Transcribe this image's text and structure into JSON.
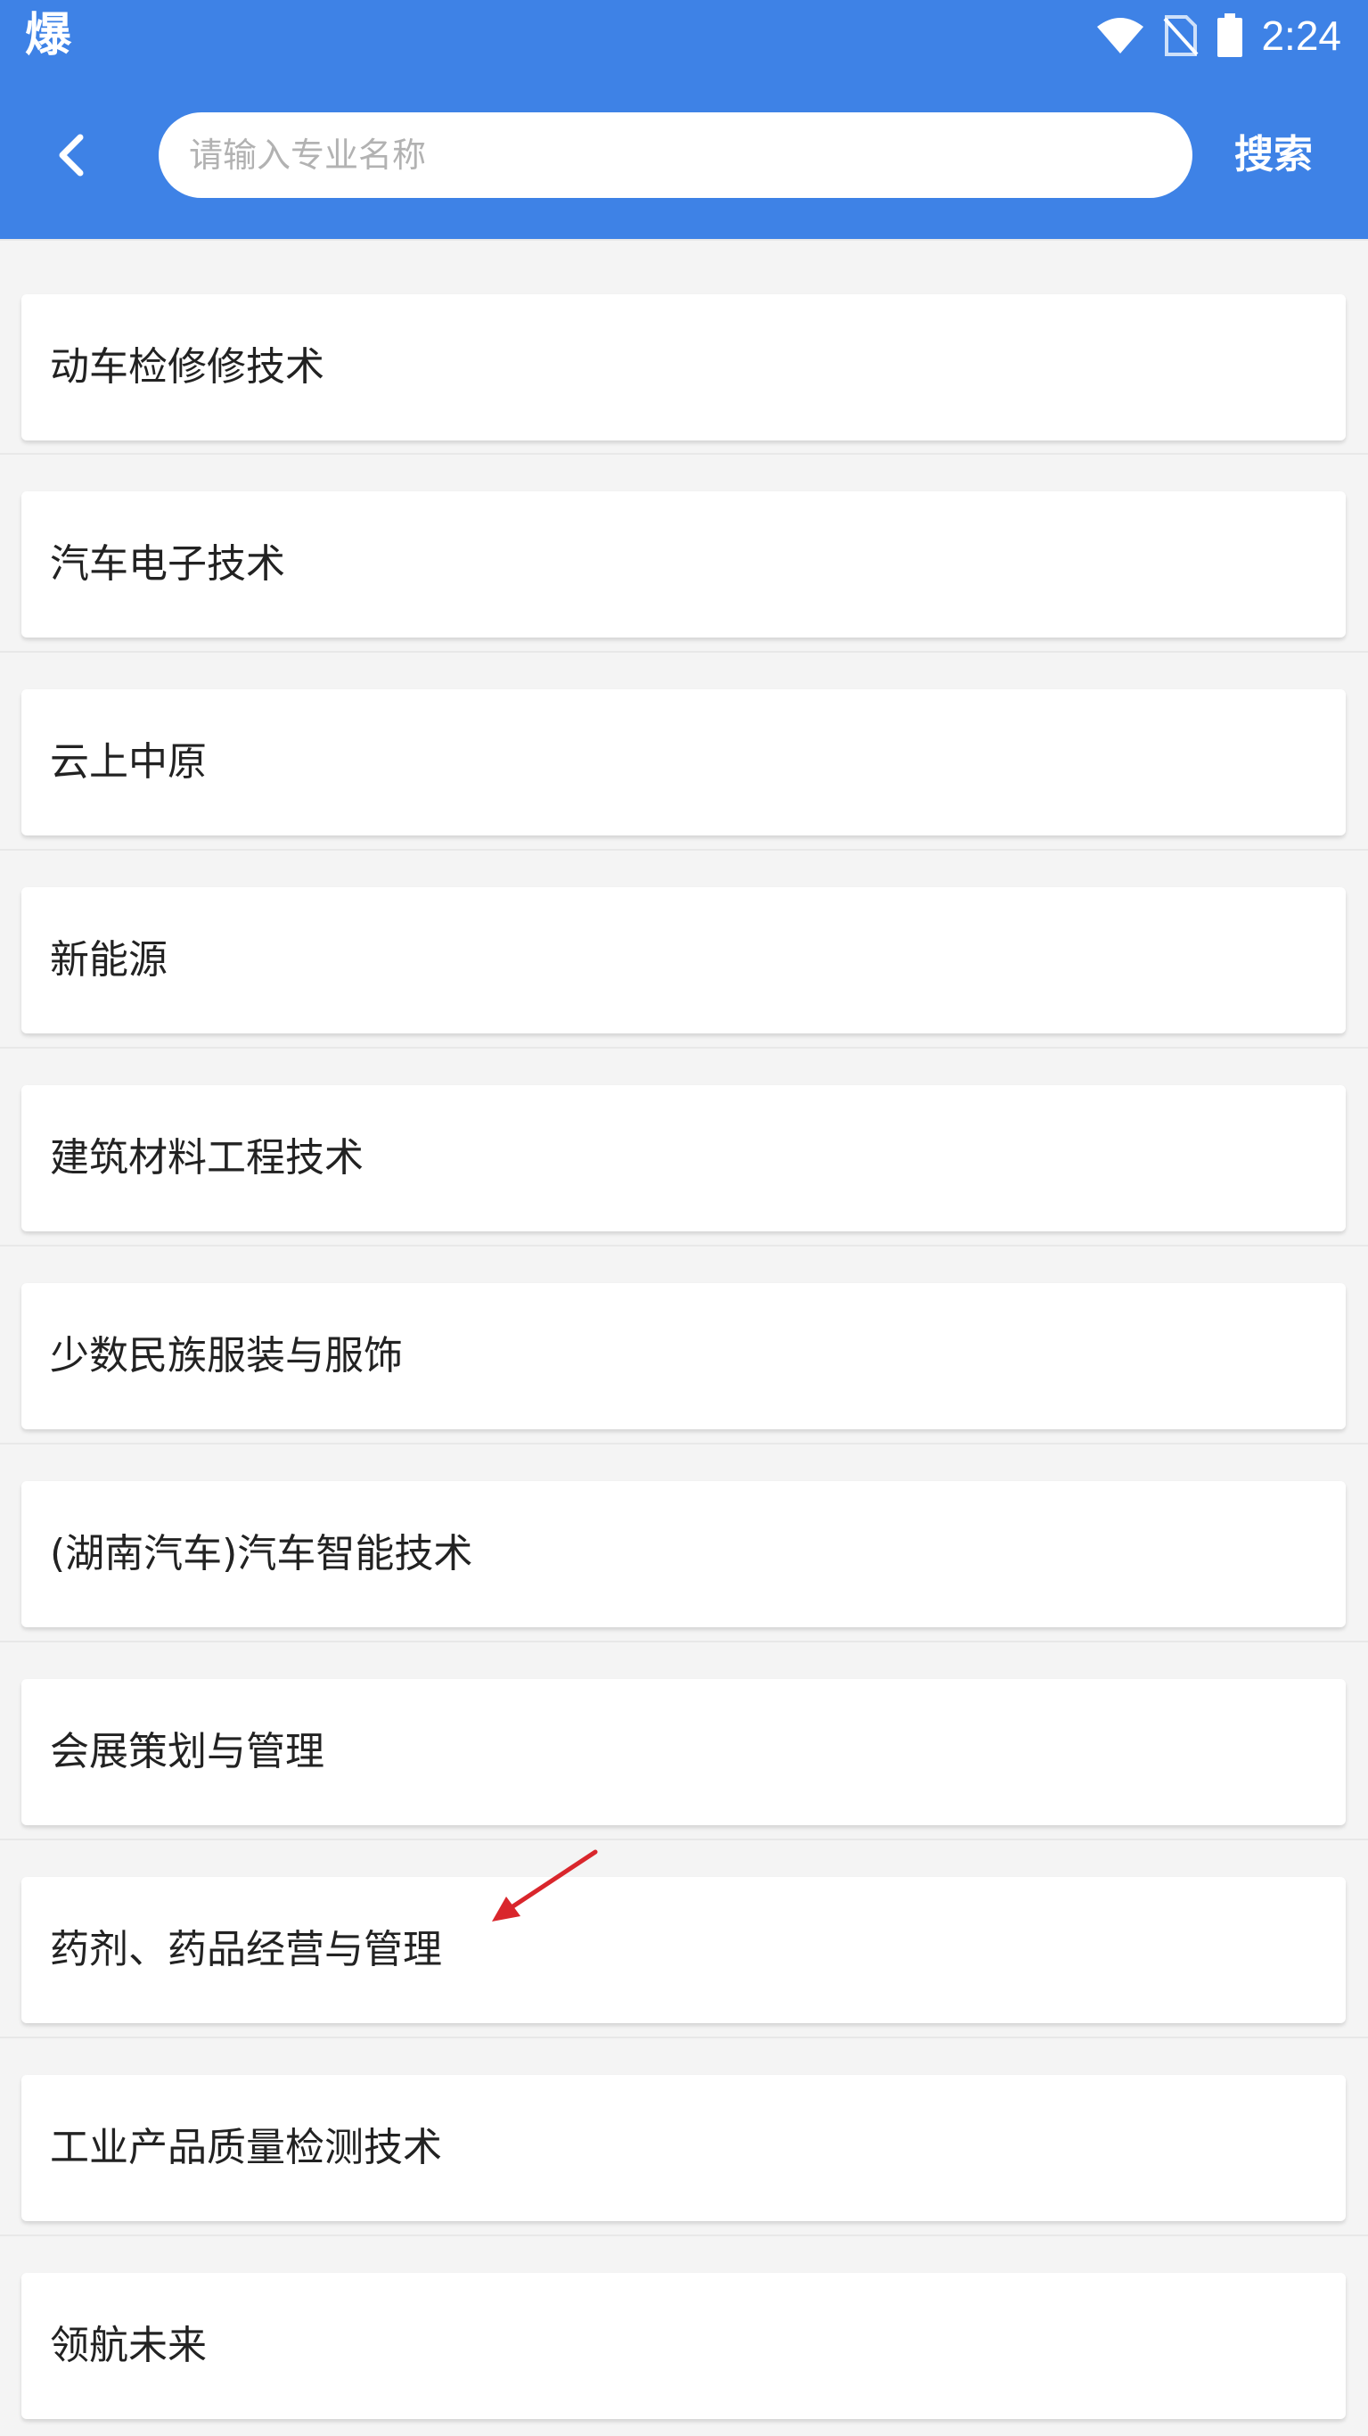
{
  "status_bar": {
    "app_icon_text": "爆",
    "time": "2:24",
    "icons": [
      "wifi-icon",
      "no-sim-icon",
      "battery-icon"
    ]
  },
  "header": {
    "background_color": "#3e82e6",
    "back_icon": "chevron-left-icon",
    "search_placeholder": "请输入专业名称",
    "search_value": "",
    "search_button_label": "搜索"
  },
  "majors": [
    "动车检修修技术",
    "汽车电子技术",
    "云上中原",
    "新能源",
    "建筑材料工程技术",
    "少数民族服装与服饰",
    "(湖南汽车)汽车智能技术",
    "会展策划与管理",
    "药剂、药品经营与管理",
    "工业产品质量检测技术",
    "领航未来"
  ],
  "annotation": {
    "arrow_color": "#d9262c",
    "points_to": "药剂、药品经营与管理"
  }
}
